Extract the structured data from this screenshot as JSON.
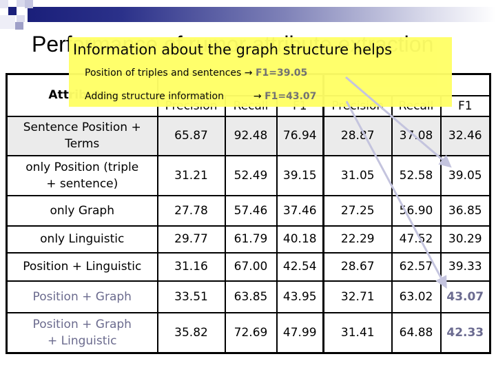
{
  "slide": {
    "title": "Performance of rumor attribute extraction",
    "colors": {
      "accent": "#1a1f7a",
      "popup_bg": "#ffff66",
      "highlight_text": "#6b6b8e",
      "row_gray": "#ebebeb",
      "arrow": "#c8c8e0"
    }
  },
  "popup": {
    "heading": "Information about the graph structure helps",
    "line1_label": "Position of triples and sentences",
    "line1_arrow": "→",
    "line1_result": "F1=39.05",
    "line2_label": "Adding structure information",
    "line2_arrow": "→",
    "line2_result": "F1=43.07"
  },
  "table": {
    "attribute_header": "Attributes",
    "group_headers": [
      "",
      ""
    ],
    "sub_headers": [
      "Precision",
      "Recall",
      "F1",
      "Precision",
      "Recall",
      "F1"
    ],
    "rows": [
      {
        "label": "Sentence Position + Terms",
        "values": [
          "65.87",
          "92.48",
          "76.94",
          "28.87",
          "37.08",
          "32.46"
        ]
      },
      {
        "label": "only Position (triple + sentence)",
        "values": [
          "31.21",
          "52.49",
          "39.15",
          "31.05",
          "52.58",
          "39.05"
        ]
      },
      {
        "label": "only Graph",
        "values": [
          "27.78",
          "57.46",
          "37.46",
          "27.25",
          "56.90",
          "36.85"
        ]
      },
      {
        "label": "only Linguistic",
        "values": [
          "29.77",
          "61.79",
          "40.18",
          "22.29",
          "47.52",
          "30.29"
        ]
      },
      {
        "label": "Position + Linguistic",
        "values": [
          "31.16",
          "67.00",
          "42.54",
          "28.67",
          "62.57",
          "39.33"
        ]
      },
      {
        "label": "Position + Graph",
        "values": [
          "33.51",
          "63.85",
          "43.95",
          "32.71",
          "63.02",
          "43.07"
        ]
      },
      {
        "label": "Position + Graph + Linguistic",
        "values": [
          "35.82",
          "72.69",
          "47.99",
          "31.41",
          "64.88",
          "42.33"
        ]
      }
    ]
  }
}
